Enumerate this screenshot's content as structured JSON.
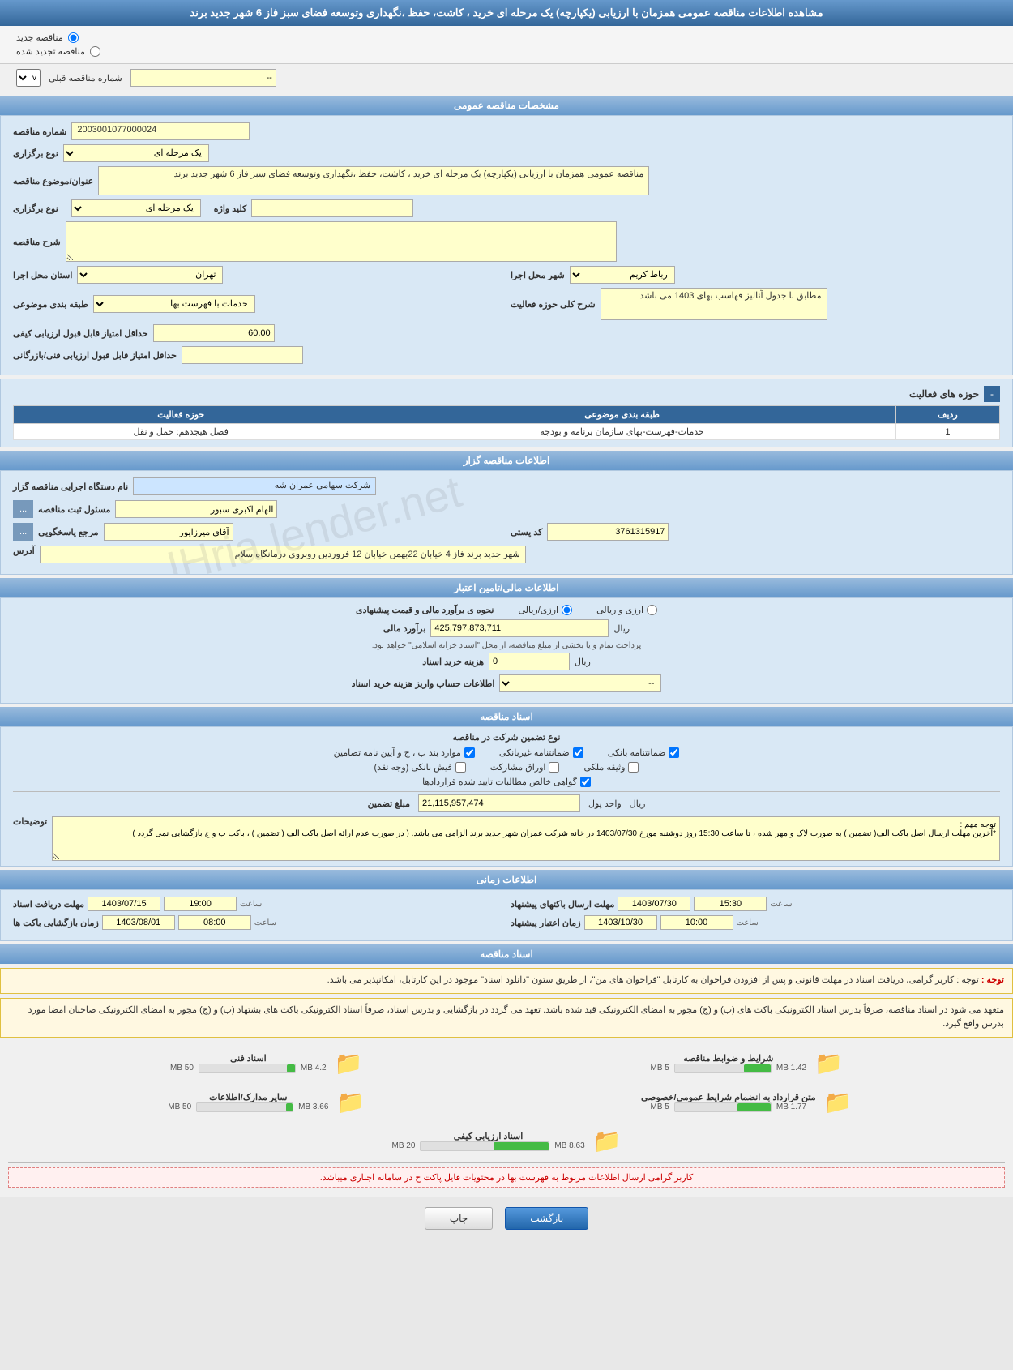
{
  "page": {
    "title": "مشاهده اطلاعات مناقصه عمومی همزمان با ارزیابی (یکپارچه) یک مرحله ای خرید ، کاشت، حفظ ،نگهداری وتوسعه فضای سبز فاز 6 شهر جدید برند",
    "radio1": "مناقصه جدید",
    "radio2": "مناقصه تجدید شده",
    "prev_tender_label": "شماره مناقصه قبلی",
    "prev_tender_value": "--"
  },
  "general_info": {
    "section_title": "مشخصات مناقصه عمومی",
    "tender_number_label": "شماره مناقصه",
    "tender_number_value": "2003001077000024",
    "type_label": "نوع برگزاری",
    "type_value": "یک مرحله ای",
    "title_label": "عنوان/موضوع مناقصه",
    "title_value": "مناقصه عمومی همزمان با ارزیابی (یکپارچه) یک مرحله ای خرید ، کاشت، حفظ ،نگهداری وتوسعه فضای سبز فاز 6 شهر جدید برند",
    "keyword_label": "کلید واژه",
    "keyword_value": "",
    "description_label": "شرح مناقصه",
    "description_value": "",
    "province_label": "استان محل اجرا",
    "province_value": "تهران",
    "city_label": "شهر محل اجرا",
    "city_value": "رباط کریم",
    "category_label": "طبقه بندی موضوعی",
    "category_value": "خدمات با فهرست بها",
    "activity_desc_label": "شرح کلی حوزه فعالیت",
    "activity_desc_value": "مطابق با جدول آنالیز فهاسب بهای 1403 می باشد",
    "min_quality_label": "حداقل امتیاز قابل قبول ارزیابی کیفی",
    "min_quality_value": "60.00",
    "min_financial_label": "حداقل امتیاز قابل قبول ارزیابی فنی/بازرگانی",
    "min_financial_value": ""
  },
  "activity_table": {
    "section_title": "حوزه های فعالیت",
    "expand_btn": "-",
    "col_row": "ردیف",
    "col_category": "طبقه بندی موضوعی",
    "col_activity": "حوزه فعالیت",
    "rows": [
      {
        "row": "1",
        "category": "خدمات-فهرست-بهای سازمان برنامه و بودجه",
        "activity": "فصل هیجدهم: حمل و نقل"
      }
    ]
  },
  "contractor_info": {
    "section_title": "اطلاعات مناقصه گزار",
    "agency_label": "نام دستگاه اجرایی مناقصه گزار",
    "agency_value": "شرکت سهامی عمران شه",
    "responsible_label": "مسئول ثبت مناقصه",
    "responsible_value": "الهام اکبری سبور",
    "ref_label": "مرجع پاسخگویی",
    "ref_value": "آقای میرزاپور",
    "postal_label": "کد پستی",
    "postal_value": "3761315917",
    "address_label": "آدرس",
    "address_value": "شهر جدید برند فاز 4 خیابان 22بهمن خیابان 12 فروردین روبروی درمانگاه سلام"
  },
  "finance_info": {
    "section_title": "اطلاعات مالی/تامین اعتبار",
    "method_label": "نحوه ی برآورد مالی و قیمت پیشنهادی",
    "method_option1": "ارزی/ریالی",
    "method_option2": "ارزی و ریالی",
    "estimate_label": "برآورد مالی",
    "estimate_value": "425,797,873,711",
    "estimate_currency": "ریال",
    "note_text": "پرداخت تمام و یا بخشی از مبلغ مناقصه، از محل \"اسناد خزانه اسلامی\" خواهد بود.",
    "bond_fee_label": "هزینه خرید اسناد",
    "bond_fee_value": "0",
    "bond_fee_currency": "ریال",
    "account_label": "اطلاعات حساب واریز هزینه خرید اسناد",
    "account_value": "--"
  },
  "guarantee_info": {
    "section_title": "اسناد مناقصه",
    "type_label": "نوع تضمین شرکت در مناقصه",
    "checkboxes": {
      "letter": "ضمانتنامه بانکی",
      "insurance": "ضمانتنامه غیربانکی",
      "cash": "موارد بند ب ، ج و آیین نامه تضامین",
      "property": "وثیقه ملکی",
      "partnership": "اوراق مشارکت",
      "check": "فیش بانکی (وجه نقد)",
      "tax": "گواهی خالص مطالبات تایید شده قراردادها"
    },
    "amount_label": "مبلغ تضمین",
    "amount_value": "21,115,957,474",
    "unit_label": "واحد پول",
    "unit_value": "ریال",
    "notes_label": "توضیحات",
    "notes_value": "توجه مهم :\n*آخرین مهلت ارسال اصل باکت الف( تضمین ) به صورت لاک و مهر شده ، تا ساعت 15:30 روز دوشنبه مورخ 1403/07/30 در خانه شرکت عمران شهر جدید برند الزامی می باشد. ( در صورت عدم ارائه اصل باکت الف ( تضمین ) ، باکت ب و ج بازگشایی نمی گردد )"
  },
  "time_info": {
    "section_title": "اطلاعات زمانی",
    "deadline_doc_label": "مهلت دریافت اسناد",
    "deadline_doc_date": "1403/07/15",
    "deadline_doc_time": "19:00",
    "deadline_submit_label": "مهلت ارسال باکتهای پیشنهاد",
    "deadline_submit_date": "1403/07/30",
    "deadline_submit_time": "15:30",
    "opening_label": "زمان بازگشایی باکت ها",
    "opening_date": "1403/08/01",
    "opening_time": "08:00",
    "validity_label": "زمان اعتبار پیشنهاد",
    "validity_date": "1403/10/30",
    "validity_time": "10:00"
  },
  "notices": {
    "notice1": "توجه : کاربر گرامی، دریافت اسناد در مهلت قانونی و پس از افزودن فراخوان به کارتابل \"فراخوان های من\"، از طریق ستون \"دانلود اسناد\" موجود در این کارتابل، امکانپذیر می باشد.",
    "notice2": "متعهد می شود در اسناد مناقصه، صرفاً بدرس اسناد الکترونیکی باکت های (ب) و (ج) مجور به امضای الکترونیکی قبد شده باشد. تعهد می گردد در بازگشایی و بدرس اسناد، صرفاً اسناد الکترونیکی باکت های بشتهاد (ب) و (ج) مجور به امضای الکترونیکی صاحبان امضا مورد بدرس واقع گیرد.",
    "bottom_notice": "کاربر گرامی ارسال اطلاعات مربوط به فهرست بها در محتویات فایل پاکت ح در سامانه اجباری میباشد."
  },
  "files": {
    "file1": {
      "label": "شرایط و ضوابط مناقصه",
      "current": "1.42 MB",
      "max": "5 MB",
      "percent": 28
    },
    "file2": {
      "label": "اسناد فنی",
      "current": "4.2 MB",
      "max": "50 MB",
      "percent": 8
    },
    "file3": {
      "label": "متن قرارداد به انضمام شرایط عمومی/خصوصی",
      "current": "1.77 MB",
      "max": "5 MB",
      "percent": 35
    },
    "file4": {
      "label": "سایر مدارک/اطلاعات",
      "current": "3.66 MB",
      "max": "50 MB",
      "percent": 7
    },
    "file5": {
      "label": "اسناد ارزیابی کیفی",
      "current": "8.63 MB",
      "max": "20 MB",
      "percent": 43
    }
  },
  "buttons": {
    "print": "چاپ",
    "back": "بازگشت"
  }
}
